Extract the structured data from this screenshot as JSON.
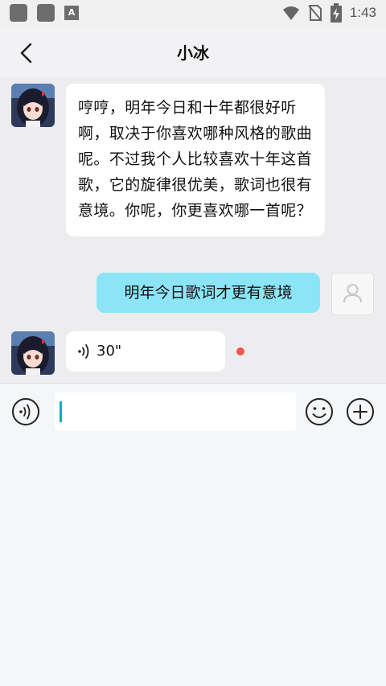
{
  "status_bar": {
    "time": "1:43",
    "left_icons": [
      "app-icon",
      "app-icon",
      "a-icon"
    ],
    "right_icons": [
      "wifi-icon",
      "no-sim-icon",
      "battery-charging-icon"
    ],
    "a_label": "A"
  },
  "header": {
    "title": "小冰"
  },
  "messages": {
    "bot_text": "哼哼，明年今日和十年都很好听啊，取决于你喜欢哪种风格的歌曲呢。不过我个人比较喜欢十年这首歌，它的旋律很优美，歌词也很有意境。你呢，你更喜欢哪一首呢？",
    "user_text": "明年今日歌词才更有意境",
    "voice_duration": "30\"",
    "voice_unread": true
  },
  "input_bar": {
    "value": "",
    "left_icon": "voice-mode-icon",
    "right_icons": [
      "emoji-icon",
      "plus-icon"
    ]
  },
  "colors": {
    "user_bubble": "#8ce5f7",
    "bot_bubble": "#ffffff",
    "unread_dot": "#f0564e",
    "caret": "#1aa6c8"
  }
}
